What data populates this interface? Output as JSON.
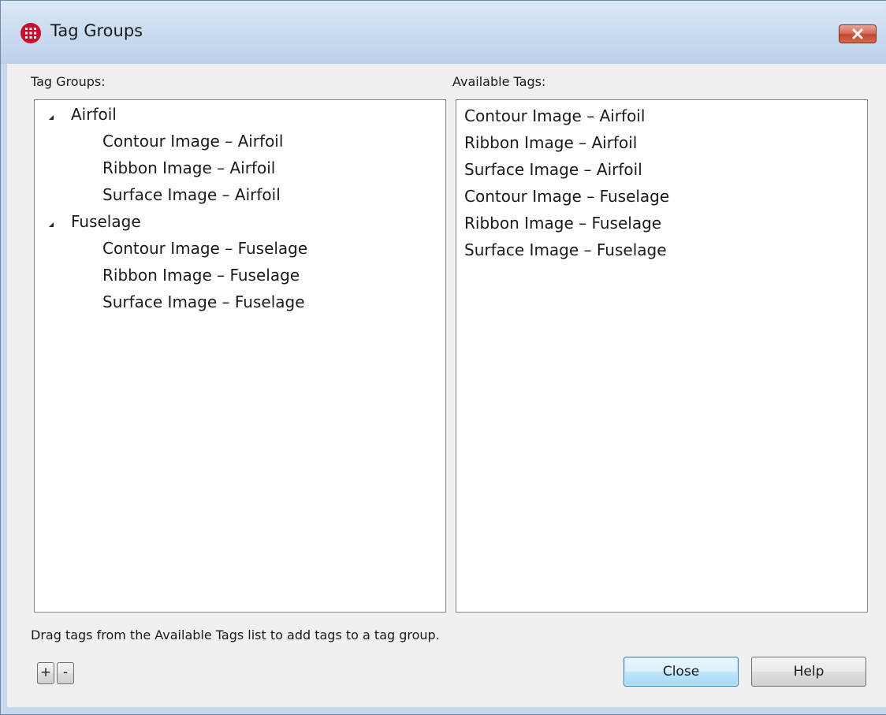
{
  "window": {
    "title": "Tag Groups",
    "close_glyph": "×"
  },
  "left_panel": {
    "label": "Tag Groups:",
    "groups": [
      {
        "name": "Airfoil",
        "items": [
          "Contour Image – Airfoil",
          "Ribbon Image – Airfoil",
          "Surface Image – Airfoil"
        ]
      },
      {
        "name": "Fuselage",
        "items": [
          "Contour Image – Fuselage",
          "Ribbon Image – Fuselage",
          "Surface Image – Fuselage"
        ]
      }
    ]
  },
  "right_panel": {
    "label": "Available Tags:",
    "items": [
      "Contour Image – Airfoil",
      "Ribbon Image – Airfoil",
      "Surface Image – Airfoil",
      "Contour Image – Fuselage",
      "Ribbon Image – Fuselage",
      "Surface Image – Fuselage"
    ]
  },
  "hint": "Drag tags from the Available Tags list to add tags to a tag group.",
  "buttons": {
    "add": "+",
    "remove": "-",
    "close": "Close",
    "help": "Help"
  },
  "icons": {
    "app": "grid-globe-icon",
    "window_close": "close-icon",
    "expander": "triangle-expanded-icon"
  },
  "colors": {
    "title_bar": "#c9dbef",
    "close_button": "#c24a32",
    "default_button": "#bee6fd",
    "app_icon": "#c8102e"
  }
}
